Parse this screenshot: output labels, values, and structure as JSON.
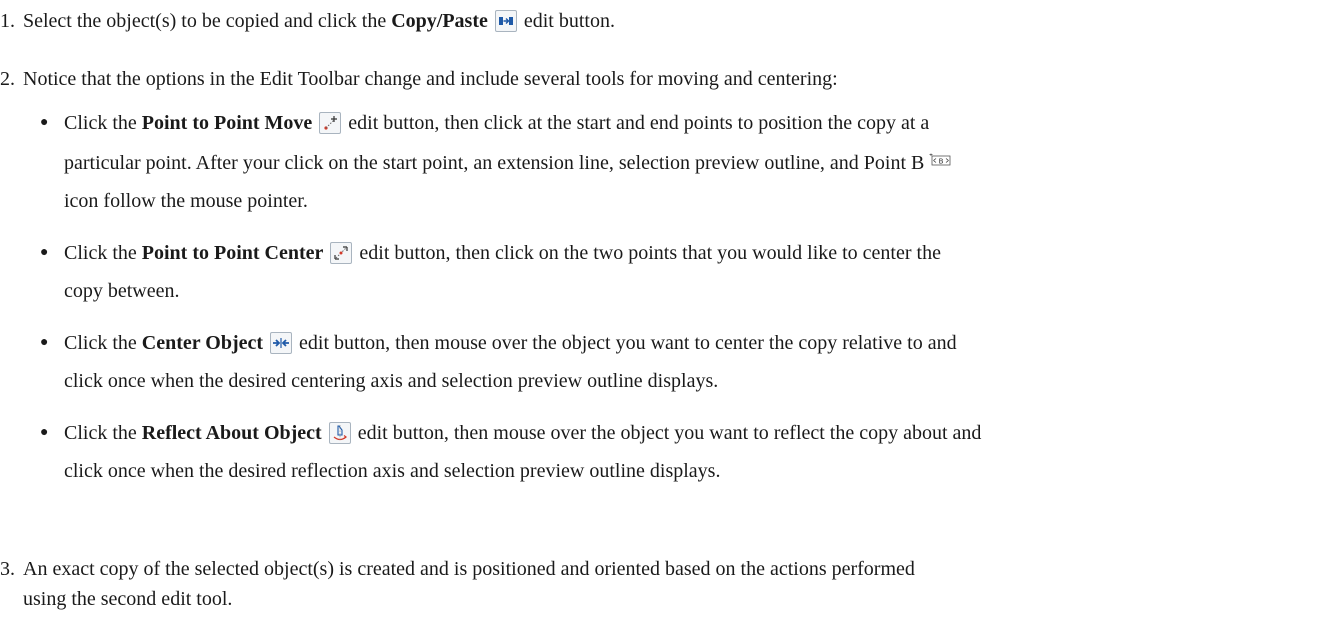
{
  "steps": [
    {
      "number": "1.",
      "pre": "Select the object(s) to be copied and click the ",
      "bold": "Copy/Paste",
      "post": " edit button.",
      "icon": "copy-paste-icon"
    },
    {
      "number": "2.",
      "text": "Notice that the options in the Edit Toolbar change and include several tools for moving and centering:"
    },
    {
      "number": "3.",
      "line1": "An exact copy of the selected object(s) is created and is positioned and oriented based on the actions performed",
      "line2": "using the second edit tool."
    }
  ],
  "bullets": [
    {
      "bold": "Point to Point Move",
      "icon": "point-to-point-move-icon",
      "line1_pre": "Click the ",
      "line1_post": " edit button, then click at the start and end points to position the copy at a",
      "line2": "particular point. After your click on the start point, an extension line, selection preview outline, and Point B",
      "line3": "icon follow the mouse pointer."
    },
    {
      "bold": "Point to Point Center",
      "icon": "point-to-point-center-icon",
      "line1_pre": "Click the ",
      "line1_post": " edit button, then click on the two points that you would like to center the",
      "line2": "copy between."
    },
    {
      "bold": "Center Object",
      "icon": "center-object-icon",
      "line1_pre": "Click the ",
      "line1_post": " edit button, then mouse over the object you want to center the copy relative to and",
      "line2": "click once when the desired centering axis and selection preview outline displays."
    },
    {
      "bold": "Reflect About Object",
      "icon": "reflect-about-object-icon",
      "line1_pre": "Click the ",
      "line1_post": " edit button, then mouse over the object you want to reflect the copy about and",
      "line2": "click once when the desired reflection axis and selection preview outline displays."
    }
  ],
  "colors": {
    "text": "#1a1a1a",
    "icon_blue": "#1f5aa8",
    "icon_red": "#d23a2a"
  }
}
